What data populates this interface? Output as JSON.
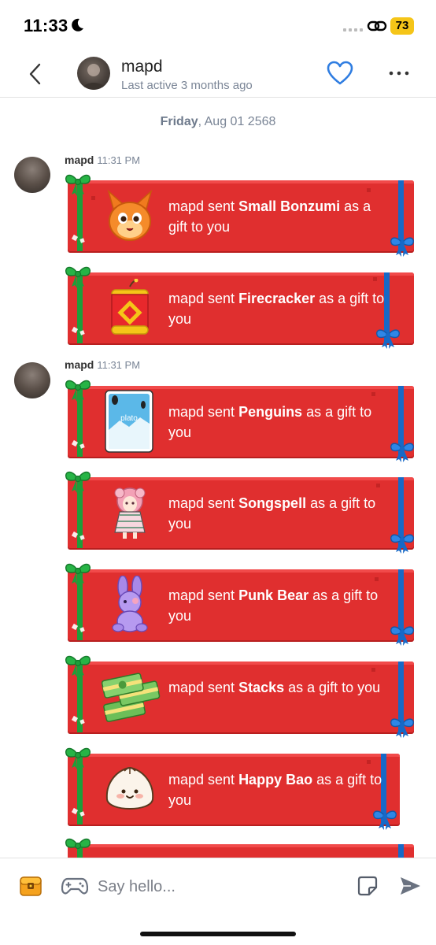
{
  "status_bar": {
    "time": "11:33",
    "battery": "73",
    "icons": [
      "moon-icon",
      "cellular-signal-icon",
      "link-icon",
      "battery-icon"
    ]
  },
  "header": {
    "name": "mapd",
    "status": "Last active 3 months ago",
    "icons": [
      "back-chevron-icon",
      "heart-icon",
      "more-dots-icon"
    ],
    "accent_color": "#2f7de1"
  },
  "date_separator": {
    "day": "Friday",
    "date": ", Aug 01 2568"
  },
  "messages": [
    {
      "sender": "mapd",
      "time": "11:31 PM",
      "gifts": [
        {
          "prefix": "mapd sent ",
          "item": "Small Bonzumi",
          "suffix": " as a gift to you",
          "icon": "bonzumi-icon"
        },
        {
          "prefix": "mapd sent ",
          "item": "Firecracker",
          "suffix": " as a gift to you",
          "icon": "firecracker-icon"
        }
      ]
    },
    {
      "sender": "mapd",
      "time": "11:31 PM",
      "gifts": [
        {
          "prefix": "mapd sent ",
          "item": "Penguins",
          "suffix": " as a gift to you",
          "icon": "penguins-card-icon",
          "card_label": "plato"
        },
        {
          "prefix": "mapd sent ",
          "item": "Songspell",
          "suffix": " as a gift to you",
          "icon": "songspell-icon"
        },
        {
          "prefix": "mapd sent ",
          "item": "Punk Bear",
          "suffix": " as a gift to you",
          "icon": "punk-bear-icon"
        },
        {
          "prefix": "mapd sent ",
          "item": "Stacks",
          "suffix": " as a gift to you",
          "icon": "money-stacks-icon"
        },
        {
          "prefix": "mapd sent ",
          "item": "Happy Bao",
          "suffix": " as a gift to you",
          "icon": "happy-bao-icon"
        }
      ]
    }
  ],
  "gift_colors": {
    "card": "#e02f2f",
    "ribbon_left": "#1e9e3a",
    "ribbon_right": "#1769c7"
  },
  "composer": {
    "placeholder": "Say hello...",
    "icons": [
      "treasure-box-icon",
      "gamepad-icon",
      "sticker-icon",
      "send-icon"
    ]
  }
}
